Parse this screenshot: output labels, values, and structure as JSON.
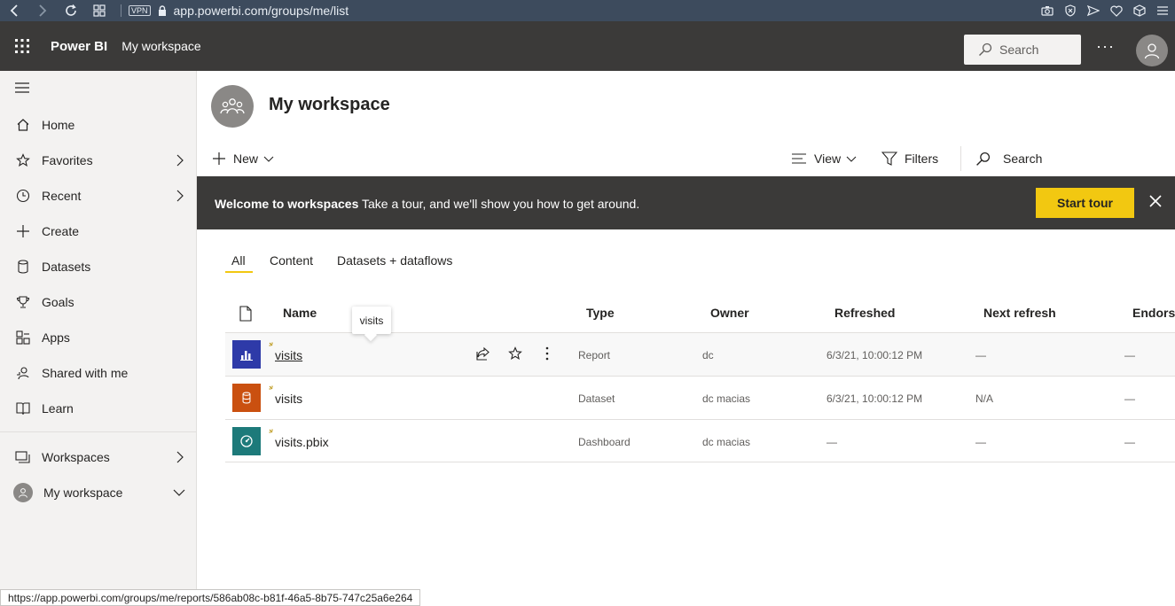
{
  "browser": {
    "url": "app.powerbi.com/groups/me/list",
    "vpn_label": "VPN"
  },
  "header": {
    "brand": "Power BI",
    "breadcrumb": "My workspace",
    "search_label": "Search",
    "more": "···"
  },
  "sidebar": {
    "items": [
      {
        "label": "Home",
        "icon": "home-icon"
      },
      {
        "label": "Favorites",
        "icon": "star-icon"
      },
      {
        "label": "Recent",
        "icon": "clock-icon"
      },
      {
        "label": "Create",
        "icon": "plus-icon"
      },
      {
        "label": "Datasets",
        "icon": "database-icon"
      },
      {
        "label": "Goals",
        "icon": "trophy-icon"
      },
      {
        "label": "Apps",
        "icon": "apps-icon"
      },
      {
        "label": "Shared with me",
        "icon": "shared-icon"
      },
      {
        "label": "Learn",
        "icon": "book-icon"
      },
      {
        "label": "Workspaces",
        "icon": "workspaces-icon"
      },
      {
        "label": "My workspace",
        "icon": "user-avatar-icon"
      }
    ]
  },
  "workspace": {
    "title": "My workspace"
  },
  "commands": {
    "new": "New",
    "view": "View",
    "filters": "Filters",
    "search": "Search"
  },
  "banner": {
    "title": "Welcome to workspaces",
    "text": "Take a tour, and we'll show you how to get around.",
    "button": "Start tour"
  },
  "tabs": [
    "All",
    "Content",
    "Datasets + dataflows"
  ],
  "table": {
    "columns": [
      "Name",
      "Type",
      "Owner",
      "Refreshed",
      "Next refresh",
      "Endorse"
    ],
    "rows": [
      {
        "name": "visits",
        "type": "Report",
        "owner": "dc",
        "refreshed": "6/3/21, 10:00:12 PM",
        "next_refresh": "—",
        "endorsement": "—",
        "icon": "report-icon",
        "color": "#2e3aa8"
      },
      {
        "name": "visits",
        "type": "Dataset",
        "owner": "dc macias",
        "refreshed": "6/3/21, 10:00:12 PM",
        "next_refresh": "N/A",
        "endorsement": "—",
        "icon": "dataset-icon",
        "color": "#ca5010"
      },
      {
        "name": "visits.pbix",
        "type": "Dashboard",
        "owner": "dc macias",
        "refreshed": "—",
        "next_refresh": "—",
        "endorsement": "—",
        "icon": "dashboard-icon",
        "color": "#1d7a7a"
      }
    ]
  },
  "tooltip": "visits",
  "status_url": "https://app.powerbi.com/groups/me/reports/586ab08c-b81f-46a5-8b75-747c25a6e264",
  "colors": {
    "header_bg": "#3b3a39",
    "accent": "#f2c811",
    "browser_bg": "#3d4b5d"
  }
}
